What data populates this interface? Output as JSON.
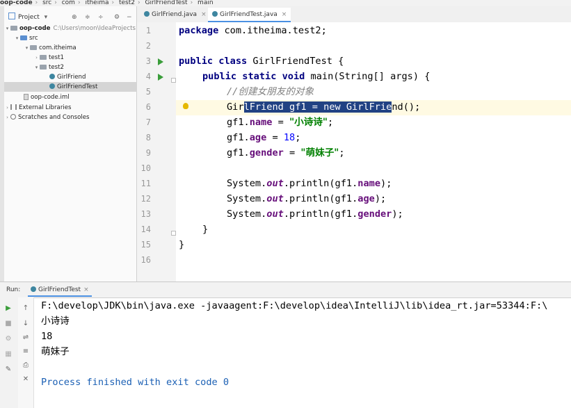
{
  "breadcrumb": [
    "oop-code",
    "src",
    "com",
    "itheima",
    "test2",
    "GirlFriendTest",
    "main"
  ],
  "project_panel": {
    "title": "Project",
    "tree": [
      {
        "label": "oop-code",
        "path": "C:\\Users\\moon\\IdeaProjects"
      },
      {
        "label": "src"
      },
      {
        "label": "com.itheima"
      },
      {
        "label": "test1"
      },
      {
        "label": "test2"
      },
      {
        "label": "GirlFriend"
      },
      {
        "label": "GirlFriendTest"
      },
      {
        "label": "oop-code.iml"
      },
      {
        "label": "External Libraries"
      },
      {
        "label": "Scratches and Consoles"
      }
    ]
  },
  "tabs": [
    {
      "label": "GirlFriend.java"
    },
    {
      "label": "GirlFriendTest.java"
    }
  ],
  "editor": {
    "line_numbers": [
      "1",
      "2",
      "3",
      "4",
      "5",
      "6",
      "7",
      "8",
      "9",
      "10",
      "11",
      "12",
      "13",
      "14",
      "15",
      "16"
    ],
    "code": {
      "l1_kw": "package",
      "l1_rest": " com.itheima.test2;",
      "l3_kw": "public class",
      "l3_rest": " GirlFriendTest {",
      "l4_kw": "public static void",
      "l4_rest": " main(String[] args) {",
      "l5_comment": "//创建女朋友的对象",
      "l6_pre": "Gir",
      "l6_sel": "lFriend gf1 = new GirlFrie",
      "l6_post": "nd();",
      "l7_obj": "gf1.",
      "l7_field": "name",
      "l7_eq": " = ",
      "l7_str": "\"小诗诗\"",
      "l7_end": ";",
      "l8_obj": "gf1.",
      "l8_field": "age",
      "l8_eq": " = ",
      "l8_num": "18",
      "l8_end": ";",
      "l9_obj": "gf1.",
      "l9_field": "gender",
      "l9_eq": " = ",
      "l9_str": "\"萌妹子\"",
      "l9_end": ";",
      "l11_a": "System.",
      "l11_out": "out",
      "l11_b": ".println(gf1.",
      "l11_field": "name",
      "l11_c": ");",
      "l12_a": "System.",
      "l12_out": "out",
      "l12_b": ".println(gf1.",
      "l12_field": "age",
      "l12_c": ");",
      "l13_a": "System.",
      "l13_out": "out",
      "l13_b": ".println(gf1.",
      "l13_field": "gender",
      "l13_c": ");",
      "l14": "}",
      "l15": "}"
    }
  },
  "run_panel": {
    "label": "Run:",
    "tab": "GirlFriendTest",
    "console": [
      "F:\\develop\\JDK\\bin\\java.exe -javaagent:F:\\develop\\idea\\IntelliJ\\lib\\idea_rt.jar=53344:F:\\",
      "小诗诗",
      "18",
      "萌妹子",
      "",
      "Process finished with exit code 0"
    ]
  },
  "colors": {
    "keyword": "#000080",
    "string": "#008000",
    "field": "#660e7a",
    "selection": "#214283",
    "run_green": "#3a9d3a"
  }
}
